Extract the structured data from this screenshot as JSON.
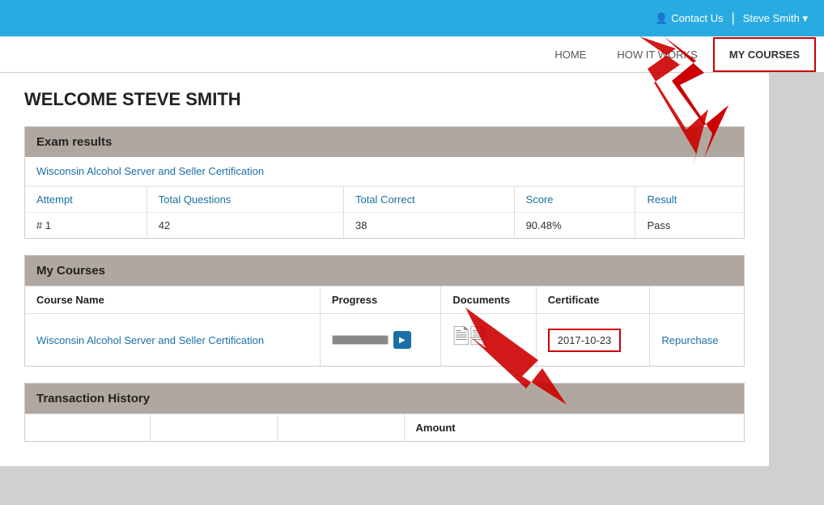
{
  "topbar": {
    "contact_label": "Contact Us",
    "user_label": "Steve Smith ▾",
    "divider": "|"
  },
  "nav": {
    "items": [
      {
        "id": "home",
        "label": "HOME",
        "active": false
      },
      {
        "id": "how-it-works",
        "label": "HOW IT WORKS",
        "active": false
      },
      {
        "id": "my-courses",
        "label": "MY COURSES",
        "active": true
      }
    ]
  },
  "welcome": {
    "title": "WELCOME STEVE SMITH"
  },
  "exam_results": {
    "section_header": "Exam results",
    "course_link": "Wisconsin Alcohol Server and Seller Certification",
    "columns": [
      "Attempt",
      "Total Questions",
      "Total Correct",
      "Score",
      "Result"
    ],
    "rows": [
      {
        "attempt": "# 1",
        "total_questions": "42",
        "total_correct": "38",
        "score": "90.48%",
        "result": "Pass"
      }
    ]
  },
  "my_courses": {
    "section_header": "My Courses",
    "columns": [
      "Course Name",
      "Progress",
      "Documents",
      "Certificate"
    ],
    "rows": [
      {
        "course_name": "Wisconsin Alcohol Server and Seller Certification",
        "progress_pct": 100,
        "certificate_date": "2017-10-23",
        "repurchase_label": "Repurchase"
      }
    ]
  },
  "transaction_history": {
    "section_header": "Transaction History",
    "columns": [
      "",
      "",
      "",
      "Amount"
    ]
  },
  "icons": {
    "contact_icon": "👤",
    "document_icon": "📋"
  }
}
